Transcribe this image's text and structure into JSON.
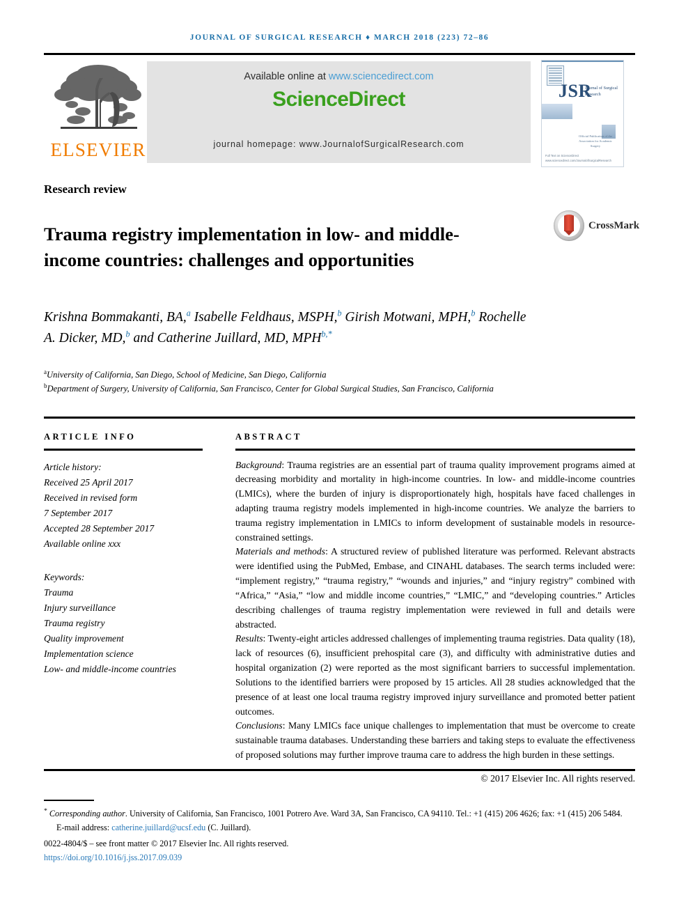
{
  "running_head": "JOURNAL OF SURGICAL RESEARCH ♦ MARCH 2018 (223) 72–86",
  "masthead": {
    "elsevier_wordmark": "ELSEVIER",
    "available_online_prefix": "Available online at ",
    "sciencedirect_url": "www.sciencedirect.com",
    "sciencedirect_logo": "ScienceDirect",
    "journal_homepage": "journal homepage: www.JournalofSurgicalResearch.com",
    "cover": {
      "title_abbrev": "JSR",
      "title_full": "Journal of Surgical Research",
      "note": "Official Publication of the Association for Academic Surgery",
      "footer": "Full Text on ScienceDirect www.sciencedirect.com/JournalofSurgicalResearch"
    }
  },
  "section_kind": "Research review",
  "title": "Trauma registry implementation in low- and middle-income countries: challenges and opportunities",
  "crossmark": {
    "label": "CrossMark"
  },
  "authors": [
    {
      "name": "Krishna Bommakanti, BA,",
      "sup": "a"
    },
    {
      "name": "Isabelle Feldhaus, MSPH,",
      "sup": "b"
    },
    {
      "name": "Girish Motwani, MPH,",
      "sup": "b"
    },
    {
      "name": "Rochelle A. Dicker, MD,",
      "sup": "b"
    },
    {
      "name": "and Catherine Juillard, MD, MPH",
      "sup": "b,*"
    }
  ],
  "affiliations": [
    {
      "marker": "a",
      "text": "University of California, San Diego, School of Medicine, San Diego, California"
    },
    {
      "marker": "b",
      "text": "Department of Surgery, University of California, San Francisco, Center for Global Surgical Studies, San Francisco, California"
    }
  ],
  "article_info": {
    "heading": "ARTICLE INFO",
    "history_label": "Article history:",
    "history": [
      "Received 25 April 2017",
      "Received in revised form",
      "7 September 2017",
      "Accepted 28 September 2017",
      "Available online xxx"
    ],
    "keywords_label": "Keywords:",
    "keywords": [
      "Trauma",
      "Injury surveillance",
      "Trauma registry",
      "Quality improvement",
      "Implementation science",
      "Low- and middle-income countries"
    ]
  },
  "abstract": {
    "heading": "ABSTRACT",
    "sections": [
      {
        "label": "Background",
        "text": ": Trauma registries are an essential part of trauma quality improvement programs aimed at decreasing morbidity and mortality in high-income countries. In low- and middle-income countries (LMICs), where the burden of injury is disproportionately high, hospitals have faced challenges in adapting trauma registry models implemented in high-income countries. We analyze the barriers to trauma registry implementation in LMICs to inform development of sustainable models in resource-constrained settings."
      },
      {
        "label": "Materials and methods",
        "text": ": A structured review of published literature was performed. Relevant abstracts were identified using the PubMed, Embase, and CINAHL databases. The search terms included were: “implement registry,” “trauma registry,” “wounds and injuries,” and “injury registry” combined with “Africa,” “Asia,” “low and middle income countries,” “LMIC,” and “developing countries.” Articles describing challenges of trauma registry implementation were reviewed in full and details were abstracted."
      },
      {
        "label": "Results",
        "text": ": Twenty-eight articles addressed challenges of implementing trauma registries. Data quality (18), lack of resources (6), insufficient prehospital care (3), and difficulty with administrative duties and hospital organization (2) were reported as the most significant barriers to successful implementation. Solutions to the identified barriers were proposed by 15 articles. All 28 studies acknowledged that the presence of at least one local trauma registry improved injury surveillance and promoted better patient outcomes."
      },
      {
        "label": "Conclusions",
        "text": ": Many LMICs face unique challenges to implementation that must be overcome to create sustainable trauma databases. Understanding these barriers and taking steps to evaluate the effectiveness of proposed solutions may further improve trauma care to address the high burden in these settings."
      }
    ],
    "copyright": "© 2017 Elsevier Inc. All rights reserved."
  },
  "footnotes": {
    "corresponding_marker": "*",
    "corresponding_label": "Corresponding author",
    "corresponding_text": ". University of California, San Francisco, 1001 Potrero Ave. Ward 3A, San Francisco, CA 94110. Tel.: +1 (415) 206 4626; fax: +1 (415) 206 5484.",
    "email_label": "E-mail address: ",
    "email": "catherine.juillard@ucsf.edu",
    "email_suffix": " (C. Juillard).",
    "issn_line": "0022-4804/$ – see front matter © 2017 Elsevier Inc. All rights reserved.",
    "doi": "https://doi.org/10.1016/j.jss.2017.09.039"
  },
  "colors": {
    "header_blue": "#1a6fa8",
    "link_blue": "#2a7ab9",
    "sciencedirect_green": "#3aa01e",
    "elsevier_orange": "#f07c00",
    "banner_gray": "#e3e3e3"
  }
}
